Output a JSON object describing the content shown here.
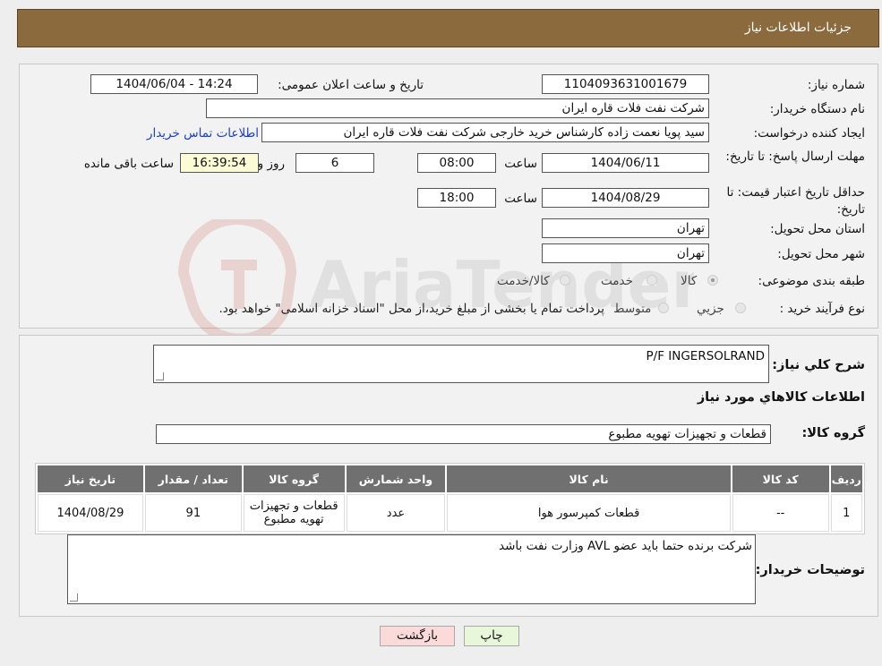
{
  "header": {
    "title": "جزئیات اطلاعات نیاز"
  },
  "info": {
    "need_number_label": "شماره نیاز:",
    "need_number": "1104093631001679",
    "announce_label": "تاریخ و ساعت اعلان عمومی:",
    "announce_value": "1404/06/04 - 14:24",
    "buyer_org_label": "نام دستگاه خریدار:",
    "buyer_org": "شرکت نفت فلات قاره ایران",
    "creator_label": "ایجاد کننده درخواست:",
    "creator": "سید پویا نعمت زاده کارشناس خرید خارجی شرکت نفت فلات قاره ایران",
    "contact_link": "اطلاعات تماس خریدار",
    "deadline_label": "مهلت ارسال پاسخ: تا تاریخ:",
    "deadline_date": "1404/06/11",
    "time_label": "ساعت",
    "deadline_time": "08:00",
    "days": "6",
    "day_and": "روز و",
    "remaining": "16:39:54",
    "remaining_label": "ساعت باقی مانده",
    "validity_label": "حداقل تاریخ اعتبار قیمت: تا تاریخ:",
    "validity_date": "1404/08/29",
    "validity_time": "18:00",
    "province_label": "استان محل تحویل:",
    "province": "تهران",
    "city_label": "شهر محل تحویل:",
    "city": "تهران",
    "category_label": "طبقه بندی موضوعی:",
    "category_options": [
      "کالا",
      "خدمت",
      "کالا/خدمت"
    ],
    "process_label": "نوع فرآیند خرید :",
    "process_options": [
      "جزیي",
      "متوسط"
    ],
    "process_note": "پرداخت تمام یا بخشی از مبلغ خرید،از محل \"اسناد خزانه اسلامی\" خواهد بود."
  },
  "details": {
    "summary_label": "شرح کلي نياز:",
    "summary_value": "P/F INGERSOLRAND",
    "goods_info_title": "اطلاعات کالاهاي مورد نياز",
    "group_label": "گروه کالا:",
    "group_value": "قطعات و تجهیزات تهویه مطبوع",
    "table": {
      "headers": [
        "ردیف",
        "کد کالا",
        "نام کالا",
        "واحد شمارش",
        "گروه کالا",
        "تعداد / مقدار",
        "تاریخ نیاز"
      ],
      "rows": [
        [
          "1",
          "--",
          "قطعات کمپرسور هوا",
          "عدد",
          "قطعات و تجهیزات تهویه مطبوع",
          "91",
          "1404/08/29"
        ]
      ]
    },
    "buyer_notes_label": "توضیحات خریدار:",
    "buyer_notes": "شرکت برنده حتما باید عضو AVL وزارت نفت باشد"
  },
  "buttons": {
    "print": "چاپ",
    "back": "بازگشت"
  },
  "watermark": {
    "text": "AriaTender.neT"
  },
  "colors": {
    "header_bg": "#8b6a3e",
    "table_header": "#707070",
    "print_btn": "#e8f7d9",
    "back_btn": "#fbdada",
    "link": "#1a3fc9"
  }
}
